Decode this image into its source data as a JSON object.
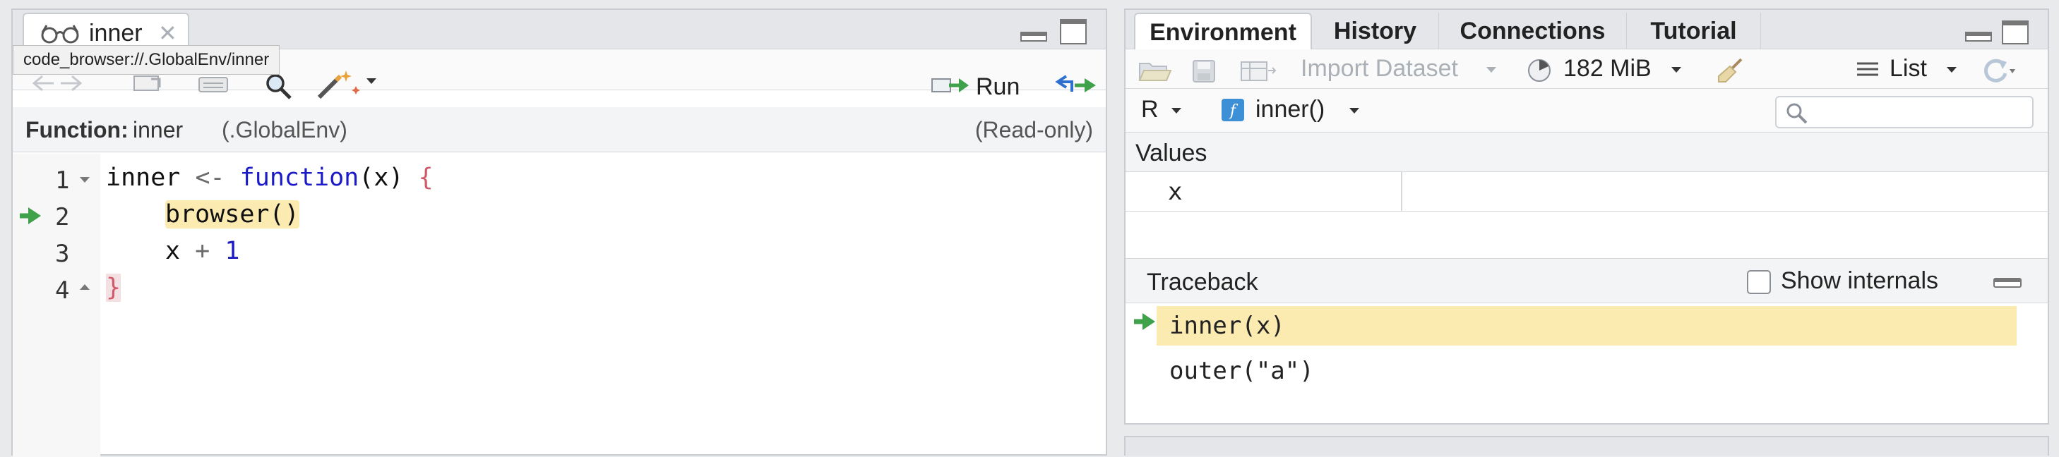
{
  "source": {
    "tab_label": "inner",
    "tooltip": "code_browser://.GlobalEnv/inner",
    "run_label": "Run",
    "function_label": "Function:",
    "function_name": "inner",
    "function_env": "(.GlobalEnv)",
    "readonly": "(Read-only)",
    "line_numbers": [
      "1",
      "2",
      "3",
      "4"
    ],
    "code": {
      "l1_name": "inner",
      "l1_arrow": "<-",
      "l1_kw": "function",
      "l1_args": "(x)",
      "l1_brace": "{",
      "l2_call": "browser()",
      "l3_x": "x",
      "l3_op": "+",
      "l3_num": "1",
      "l4_brace": "}"
    }
  },
  "environment": {
    "tabs": [
      "Environment",
      "History",
      "Connections",
      "Tutorial"
    ],
    "active_tab": "Environment",
    "toolbar": {
      "import_label": "Import Dataset",
      "memory_label": "182 MiB",
      "view_label": "List"
    },
    "scope": {
      "language": "R",
      "frame": "inner()"
    },
    "values_header": "Values",
    "values": [
      {
        "name": "x",
        "value": ""
      }
    ],
    "traceback_header": "Traceback",
    "show_internals_label": "Show internals",
    "traceback": [
      "inner(x)",
      "outer(\"a\")"
    ]
  },
  "colors": {
    "highlight": "#fcebb1",
    "arrow": "#3fa14a",
    "keyword": "#1a1ac6",
    "brace": "#d05a6a"
  }
}
